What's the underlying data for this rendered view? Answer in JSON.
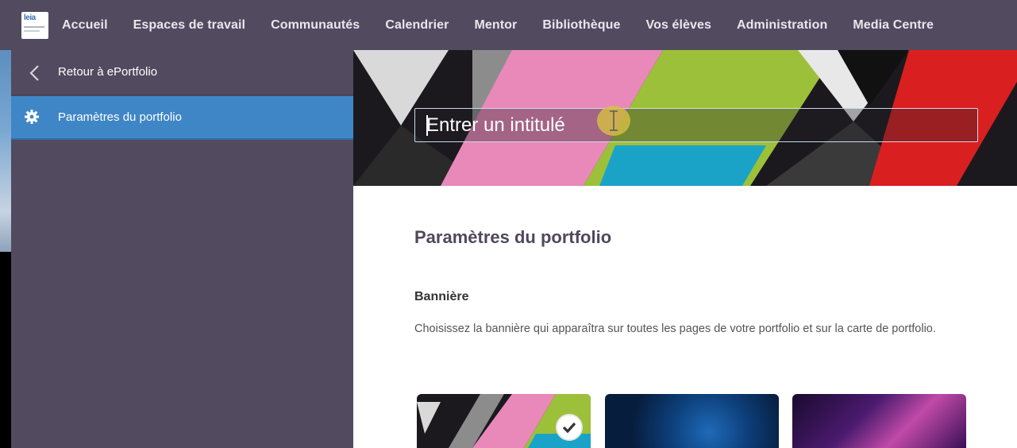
{
  "nav": {
    "items": [
      {
        "label": "Accueil"
      },
      {
        "label": "Espaces de travail"
      },
      {
        "label": "Communautés"
      },
      {
        "label": "Calendrier"
      },
      {
        "label": "Mentor"
      },
      {
        "label": "Bibliothèque"
      },
      {
        "label": "Vos élèves"
      },
      {
        "label": "Administration"
      },
      {
        "label": "Media Centre"
      }
    ],
    "logo_text": "leia",
    "background_color": "#524a5f"
  },
  "sidebar": {
    "back_label": "Retour à ePortfolio",
    "back_icon": "chevron-left-icon",
    "active_item": {
      "label": "Paramètres du portfolio",
      "icon": "gear-icon"
    },
    "background_color": "#524a5f",
    "active_color": "#3f86c7"
  },
  "banner": {
    "title_input": {
      "value": "",
      "placeholder": "Entrer un intitulé"
    }
  },
  "content": {
    "page_title": "Paramètres du portfolio",
    "section_title": "Bannière",
    "section_description": "Choisissez la bannière qui apparaîtra sur toutes les pages de votre portfolio et sur la carte de portfolio.",
    "banner_options": [
      {
        "name": "geometric-triangles",
        "selected": true
      },
      {
        "name": "blue-network",
        "selected": false
      },
      {
        "name": "purple-light",
        "selected": false
      }
    ]
  },
  "icons": {
    "selected_badge": "checkmark-icon",
    "text_cursor": "i-beam-cursor-icon"
  }
}
